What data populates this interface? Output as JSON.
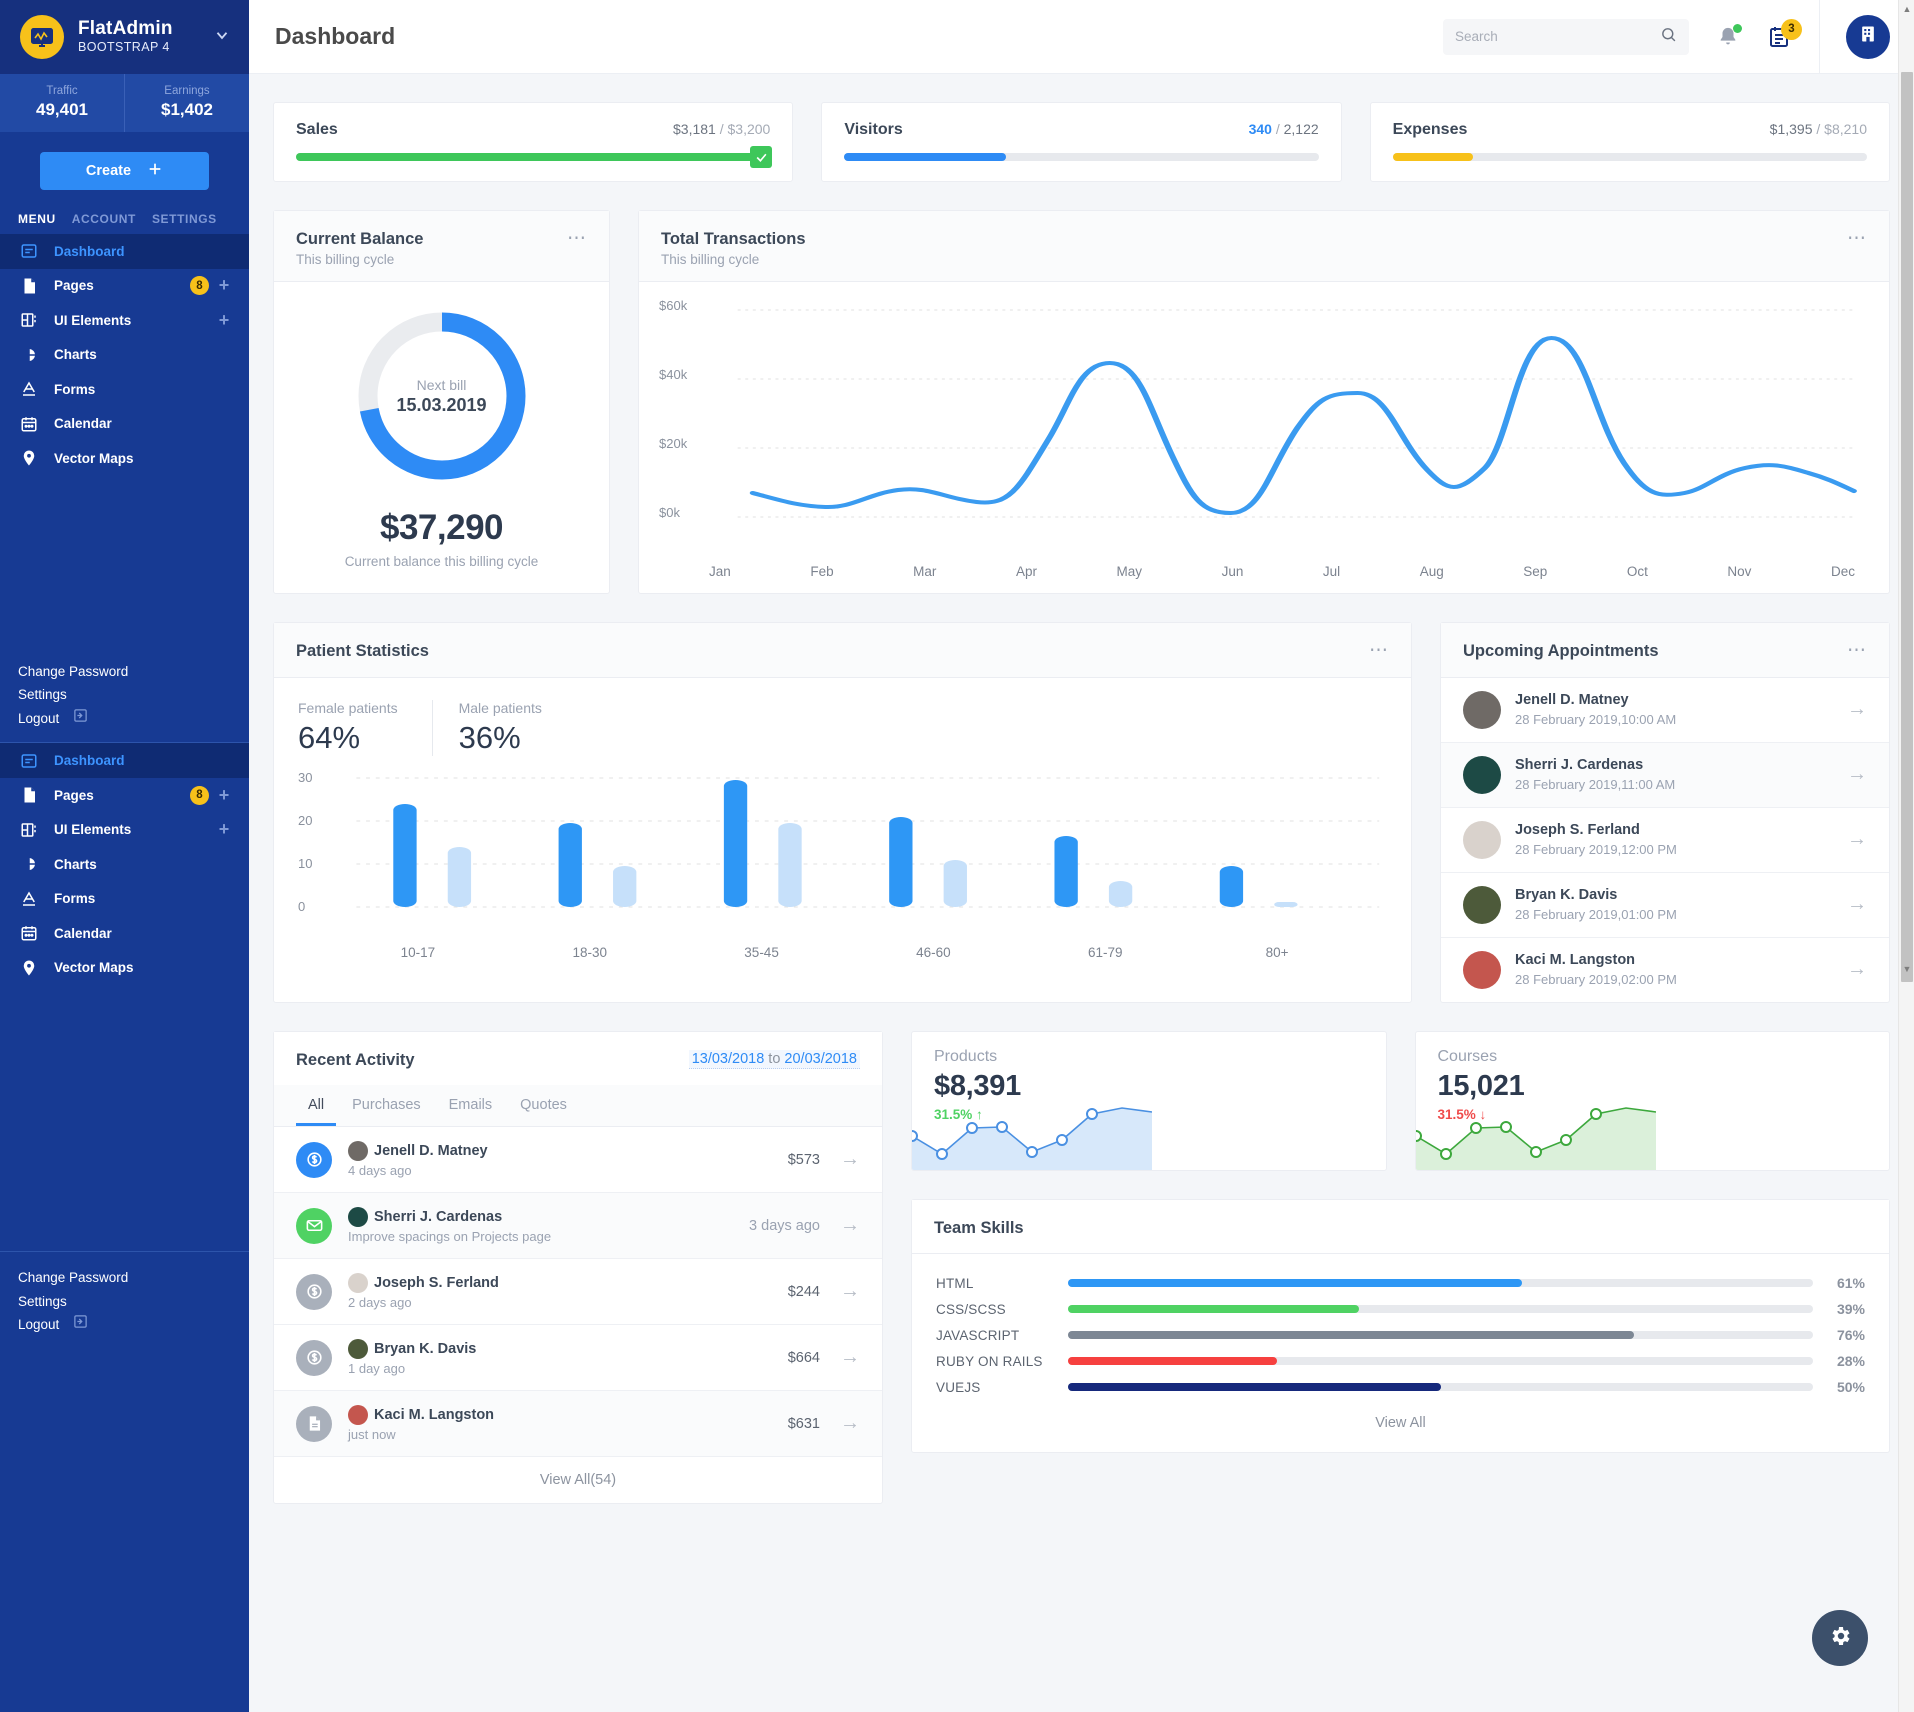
{
  "sidebar": {
    "brand": {
      "title": "FlatAdmin",
      "subtitle": "BOOTSTRAP 4",
      "logo_icon": "monitor-chart-icon",
      "caret_icon": "chevron-down-icon"
    },
    "stats": [
      {
        "label": "Traffic",
        "value": "49,401"
      },
      {
        "label": "Earnings",
        "value": "$1,402"
      }
    ],
    "create_label": "Create",
    "create_icon": "plus-icon",
    "navtabs": [
      {
        "label": "MENU",
        "active": true
      },
      {
        "label": "ACCOUNT",
        "active": false
      },
      {
        "label": "SETTINGS",
        "active": false
      }
    ],
    "menu": [
      {
        "label": "Dashboard",
        "icon": "dashboard-icon",
        "active": true,
        "badge": "",
        "plus": false
      },
      {
        "label": "Pages",
        "icon": "file-icon",
        "active": false,
        "badge": "8",
        "plus": true
      },
      {
        "label": "UI Elements",
        "icon": "grid-icon",
        "active": false,
        "badge": "",
        "plus": true
      },
      {
        "label": "Charts",
        "icon": "pie-chart-icon",
        "active": false,
        "badge": "",
        "plus": false
      },
      {
        "label": "Forms",
        "icon": "text-format-icon",
        "active": false,
        "badge": "",
        "plus": false
      },
      {
        "label": "Calendar",
        "icon": "calendar-icon",
        "active": false,
        "badge": "",
        "plus": false
      },
      {
        "label": "Vector Maps",
        "icon": "map-pin-icon",
        "active": false,
        "badge": "",
        "plus": false
      }
    ],
    "account_links": [
      {
        "label": "Change Password",
        "icon": ""
      },
      {
        "label": "Settings",
        "icon": ""
      },
      {
        "label": "Logout",
        "icon": "logout-icon"
      }
    ]
  },
  "topbar": {
    "page_title": "Dashboard",
    "search_placeholder": "Search",
    "search_value": "",
    "search_icon": "search-icon",
    "bell_icon": "bell-icon",
    "calendar_icon": "calendar-icon",
    "calendar_badge": "3",
    "avatar_icon": "building-icon"
  },
  "progress_cards": [
    {
      "name": "Sales",
      "current": "$3,181",
      "sep": " / ",
      "total": "$3,200",
      "percent": 99,
      "color": "#3ec75a",
      "highlight_current": false,
      "complete": true,
      "check_icon": "check-icon"
    },
    {
      "name": "Visitors",
      "current": "340",
      "sep": " / ",
      "total": "2,122",
      "percent": 34,
      "color": "#2e8bf5",
      "highlight_current": true,
      "complete": false,
      "check_icon": ""
    },
    {
      "name": "Expenses",
      "current": "$1,395",
      "sep": " / ",
      "total": "$8,210",
      "percent": 17,
      "color": "#f7c11a",
      "highlight_current": false,
      "complete": false,
      "check_icon": ""
    }
  ],
  "balance_card": {
    "title": "Current Balance",
    "subtitle": "This billing cycle",
    "menu_icon": "more-horizontal-icon",
    "donut_label": "Next bill",
    "donut_value": "15.03.2019",
    "donut_percent": 72,
    "donut_color": "#2e8bf5",
    "donut_track_color": "#eaecef",
    "amount": "$37,290",
    "note": "Current balance this billing cycle"
  },
  "transactions_card": {
    "title": "Total Transactions",
    "subtitle": "This billing cycle",
    "menu_icon": "more-horizontal-icon"
  },
  "patient_card": {
    "title": "Patient Statistics",
    "menu_icon": "more-horizontal-icon",
    "female_label": "Female patients",
    "female_value": "64%",
    "male_label": "Male patients",
    "male_value": "36%"
  },
  "appointments_card": {
    "title": "Upcoming Appointments",
    "menu_icon": "more-horizontal-icon",
    "items": [
      {
        "name": "Jenell D. Matney",
        "time": "28 February 2019,10:00 AM",
        "avatar": "#6f6a66",
        "arrow_icon": "arrow-right-icon"
      },
      {
        "name": "Sherri J. Cardenas",
        "time": "28 February 2019,11:00 AM",
        "avatar": "#1d4a45",
        "arrow_icon": "arrow-right-icon"
      },
      {
        "name": "Joseph S. Ferland",
        "time": "28 February 2019,12:00 PM",
        "avatar": "#d9d2cc",
        "arrow_icon": "arrow-right-icon"
      },
      {
        "name": "Bryan K. Davis",
        "time": "28 February 2019,01:00 PM",
        "avatar": "#4d5a3a",
        "arrow_icon": "arrow-right-icon"
      },
      {
        "name": "Kaci M. Langston",
        "time": "28 February 2019,02:00 PM",
        "avatar": "#c4564e",
        "arrow_icon": "arrow-right-icon"
      }
    ]
  },
  "activity_card": {
    "title": "Recent Activity",
    "date_from": "13/03/2018",
    "date_to_label": "to",
    "date_to": "20/03/2018",
    "tabs": [
      {
        "label": "All",
        "active": true
      },
      {
        "label": "Purchases",
        "active": false
      },
      {
        "label": "Emails",
        "active": false
      },
      {
        "label": "Quotes",
        "active": false
      }
    ],
    "items": [
      {
        "name": "Jenell D. Matney",
        "sub": "4 days ago",
        "right": "$573",
        "right_muted": false,
        "icon": "dollar-icon",
        "icon_bg": "#2e8bf5",
        "avatar": "#6f6a66",
        "arrow_icon": "arrow-right-icon"
      },
      {
        "name": "Sherri J. Cardenas",
        "sub": "Improve spacings on Projects page",
        "right": "3 days ago",
        "right_muted": true,
        "icon": "envelope-icon",
        "icon_bg": "#4fd263",
        "avatar": "#1d4a45",
        "arrow_icon": "arrow-right-icon"
      },
      {
        "name": "Joseph S. Ferland",
        "sub": "2 days ago",
        "right": "$244",
        "right_muted": false,
        "icon": "dollar-icon",
        "icon_bg": "#a9b0bb",
        "avatar": "#d9d2cc",
        "arrow_icon": "arrow-right-icon"
      },
      {
        "name": "Bryan K. Davis",
        "sub": "1 day ago",
        "right": "$664",
        "right_muted": false,
        "icon": "dollar-icon",
        "icon_bg": "#a9b0bb",
        "avatar": "#4d5a3a",
        "arrow_icon": "arrow-right-icon"
      },
      {
        "name": "Kaci M. Langston",
        "sub": "just now",
        "right": "$631",
        "right_muted": false,
        "icon": "document-icon",
        "icon_bg": "#a9b0bb",
        "avatar": "#c4564e",
        "arrow_icon": "arrow-right-icon"
      }
    ],
    "view_all": "View All(54)"
  },
  "mini_cards": [
    {
      "title": "Products",
      "value": "$8,391",
      "delta": "31.5%",
      "delta_dir": "up",
      "delta_icon": "arrow-up-icon",
      "delta_color": "#4fd263",
      "line_color": "#4a90e2",
      "fill_color": "#d7e8fa"
    },
    {
      "title": "Courses",
      "value": "15,021",
      "delta": "31.5%",
      "delta_dir": "down",
      "delta_icon": "arrow-down-icon",
      "delta_color": "#ef4b4b",
      "line_color": "#3da83d",
      "fill_color": "#dbf0da"
    }
  ],
  "team_skills": {
    "title": "Team Skills",
    "view_all": "View All",
    "skills": [
      {
        "name": "HTML",
        "percent": 61,
        "label": "61%",
        "color": "#2e97f5"
      },
      {
        "name": "CSS/SCSS",
        "percent": 39,
        "label": "39%",
        "color": "#4fd263"
      },
      {
        "name": "JAVASCRIPT",
        "percent": 76,
        "label": "76%",
        "color": "#7d8794"
      },
      {
        "name": "RUBY ON RAILS",
        "percent": 28,
        "label": "28%",
        "color": "#f6403f"
      },
      {
        "name": "VUEJS",
        "percent": 50,
        "label": "50%",
        "color": "#16297c"
      }
    ]
  },
  "fab": {
    "icon": "gear-icon"
  },
  "chart_data": [
    {
      "type": "line",
      "title": "Total Transactions",
      "subtitle": "This billing cycle",
      "xlabel": "",
      "ylabel": "",
      "categories": [
        "Jan",
        "Feb",
        "Mar",
        "Apr",
        "May",
        "Jun",
        "Jul",
        "Aug",
        "Sep",
        "Oct",
        "Nov",
        "Dec"
      ],
      "ytick_labels": [
        "$0k",
        "$20k",
        "$40k",
        "$60k"
      ],
      "ytick_values": [
        0,
        20000,
        40000,
        60000
      ],
      "ylim": [
        0,
        60000
      ],
      "grid": true,
      "legend": "none",
      "series": [
        {
          "name": "Transactions",
          "color": "#3a9bf0",
          "values": [
            7000,
            4500,
            8200,
            4600,
            44500,
            3500,
            36000,
            13500,
            55000,
            18000,
            24000,
            20000
          ]
        }
      ]
    },
    {
      "type": "bar",
      "title": "Patient Statistics",
      "xlabel": "",
      "ylabel": "",
      "categories": [
        "10-17",
        "18-30",
        "35-45",
        "46-60",
        "61-79",
        "80+"
      ],
      "ytick_labels": [
        "0",
        "10",
        "20",
        "30"
      ],
      "ylim": [
        0,
        30
      ],
      "grid": true,
      "legend": "none",
      "series": [
        {
          "name": "Female patients",
          "color": "#2e97f5",
          "values": [
            24,
            19.5,
            29.5,
            21,
            16.5,
            9.5
          ]
        },
        {
          "name": "Male patients",
          "color": "#c6e0fa",
          "values": [
            14,
            9.5,
            19.5,
            11,
            6,
            1
          ]
        }
      ]
    },
    {
      "type": "area",
      "title": "Products",
      "categories": [
        "1",
        "2",
        "3",
        "4",
        "5",
        "6",
        "7",
        "8"
      ],
      "values": [
        42,
        18,
        55,
        56,
        20,
        38,
        78,
        90
      ],
      "ylim": [
        0,
        100
      ],
      "grid": false,
      "legend": "none",
      "series": [
        {
          "name": "Products",
          "color": "#4a90e2",
          "values": [
            42,
            18,
            55,
            56,
            20,
            38,
            78,
            90
          ]
        }
      ]
    },
    {
      "type": "area",
      "title": "Courses",
      "categories": [
        "1",
        "2",
        "3",
        "4",
        "5",
        "6",
        "7",
        "8"
      ],
      "values": [
        42,
        18,
        55,
        56,
        20,
        38,
        78,
        90
      ],
      "ylim": [
        0,
        100
      ],
      "grid": false,
      "legend": "none",
      "series": [
        {
          "name": "Courses",
          "color": "#3da83d",
          "values": [
            42,
            18,
            55,
            56,
            20,
            38,
            78,
            90
          ]
        }
      ]
    },
    {
      "type": "bar",
      "title": "Team Skills",
      "categories": [
        "HTML",
        "CSS/SCSS",
        "JAVASCRIPT",
        "RUBY ON RAILS",
        "VUEJS"
      ],
      "values": [
        61,
        39,
        76,
        28,
        50
      ],
      "ylim": [
        0,
        100
      ],
      "grid": false,
      "legend": "none"
    },
    {
      "type": "pie",
      "title": "Current Balance",
      "labels": [
        "Used",
        "Remaining"
      ],
      "values": [
        72,
        28
      ],
      "colors": [
        "#2e8bf5",
        "#eaecef"
      ],
      "center_label": "Next bill",
      "center_value": "15.03.2019"
    }
  ]
}
